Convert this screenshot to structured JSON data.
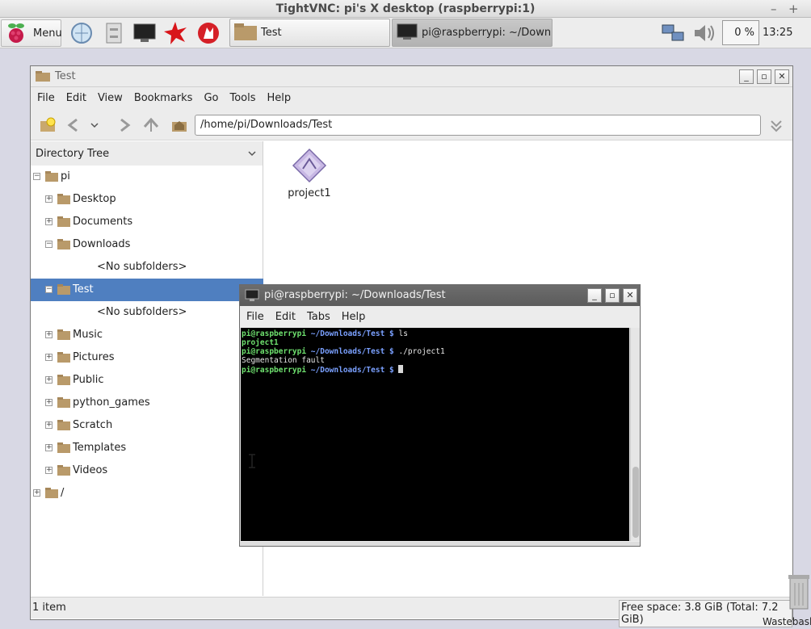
{
  "vnc": {
    "title": "TightVNC: pi's X desktop (raspberrypi:1)",
    "min": "–",
    "max": "+"
  },
  "panel": {
    "menu_label": "Menu",
    "task_test": "Test",
    "task_terminal": "pi@raspberrypi: ~/Downloa...",
    "cpu": "0 %",
    "clock": "13:25"
  },
  "file_manager": {
    "title": "Test",
    "menu": [
      "File",
      "Edit",
      "View",
      "Bookmarks",
      "Go",
      "Tools",
      "Help"
    ],
    "path": "/home/pi/Downloads/Test",
    "sidebar_header": "Directory Tree",
    "tree": [
      {
        "label": "pi",
        "exp": "−"
      },
      {
        "label": "Desktop",
        "exp": "+"
      },
      {
        "label": "Documents",
        "exp": "+"
      },
      {
        "label": "Downloads",
        "exp": "−"
      },
      {
        "label": "<No subfolders>",
        "exp": ""
      },
      {
        "label": "Test",
        "exp": "−"
      },
      {
        "label": "<No subfolders>",
        "exp": ""
      },
      {
        "label": "Music",
        "exp": "+"
      },
      {
        "label": "Pictures",
        "exp": "+"
      },
      {
        "label": "Public",
        "exp": "+"
      },
      {
        "label": "python_games",
        "exp": "+"
      },
      {
        "label": "Scratch",
        "exp": "+"
      },
      {
        "label": "Templates",
        "exp": "+"
      },
      {
        "label": "Videos",
        "exp": "+"
      },
      {
        "label": "/",
        "exp": "+"
      }
    ],
    "file_name": "project1",
    "status_count": "1 item",
    "status_space": "Free space: 3.8 GiB (Total: 7.2 GiB)"
  },
  "terminal": {
    "title": "pi@raspberrypi: ~/Downloads/Test",
    "menu": [
      "File",
      "Edit",
      "Tabs",
      "Help"
    ],
    "lines": [
      {
        "user": "pi@raspberrypi",
        "path": " ~/Downloads/Test $",
        "cmd": " ls"
      },
      {
        "user": "project1",
        "path": "",
        "cmd": ""
      },
      {
        "user": "pi@raspberrypi",
        "path": " ~/Downloads/Test $",
        "cmd": " ./project1"
      },
      {
        "user": "",
        "path": "",
        "cmd": "Segmentation fault"
      },
      {
        "user": "pi@raspberrypi",
        "path": " ~/Downloads/Test $",
        "cmd": " "
      }
    ]
  },
  "desktop": {
    "wastebasket": "Wastebasket"
  }
}
